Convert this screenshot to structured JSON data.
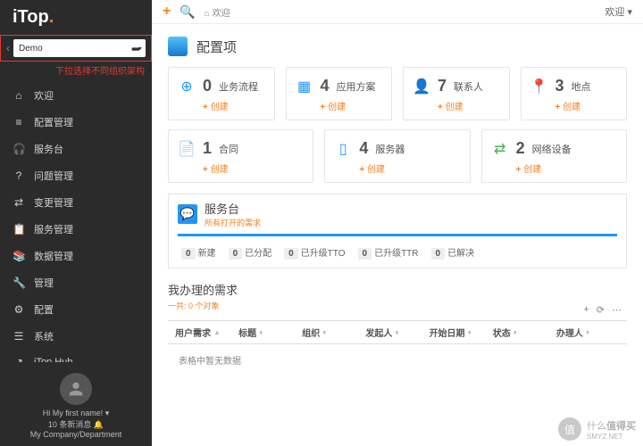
{
  "logo": {
    "text": "iTop",
    "accent": "."
  },
  "org": {
    "selected": "Demo",
    "hint": "下拉选择不同组织架构"
  },
  "nav": [
    {
      "icon": "home",
      "label": "欢迎"
    },
    {
      "icon": "db",
      "label": "配置管理"
    },
    {
      "icon": "headset",
      "label": "服务台"
    },
    {
      "icon": "question",
      "label": "问题管理"
    },
    {
      "icon": "exchange",
      "label": "变更管理"
    },
    {
      "icon": "clipboard",
      "label": "服务管理"
    },
    {
      "icon": "book",
      "label": "数据管理"
    },
    {
      "icon": "wrench",
      "label": "管理"
    },
    {
      "icon": "gear",
      "label": "配置"
    },
    {
      "icon": "sliders",
      "label": "系统"
    },
    {
      "icon": "share",
      "label": "iTop Hub"
    }
  ],
  "user": {
    "greeting": "Hi My first name! ▾",
    "msgs": "10 条新消息 🔔",
    "dept": "My Company/Department"
  },
  "topbar": {
    "breadcrumb_icon": "⌂",
    "breadcrumb": "欢迎",
    "right": "欢迎 ▾"
  },
  "section1": {
    "title": "配置项"
  },
  "cards1": [
    {
      "icon": "⊕",
      "color": "#2196f3",
      "count": "0",
      "label": "业务流程",
      "add": "创建"
    },
    {
      "icon": "▦",
      "color": "#2196f3",
      "count": "4",
      "label": "应用方案",
      "add": "创建"
    },
    {
      "icon": "👤",
      "color": "#2196f3",
      "count": "7",
      "label": "联系人",
      "add": "创建"
    },
    {
      "icon": "📍",
      "color": "#ff9800",
      "count": "3",
      "label": "地点",
      "add": "创建"
    }
  ],
  "cards2": [
    {
      "icon": "📄",
      "color": "#2196f3",
      "count": "1",
      "label": "合同",
      "add": "创建"
    },
    {
      "icon": "▯",
      "color": "#2196f3",
      "count": "4",
      "label": "服务器",
      "add": "创建"
    },
    {
      "icon": "⇄",
      "color": "#4caf50",
      "count": "2",
      "label": "网络设备",
      "add": "创建"
    }
  ],
  "service": {
    "title": "服务台",
    "subtitle": "所有打开的需求",
    "chips": [
      {
        "n": "0",
        "t": "新建"
      },
      {
        "n": "0",
        "t": "已分配"
      },
      {
        "n": "0",
        "t": "已升级TTO"
      },
      {
        "n": "0",
        "t": "已升级TTR"
      },
      {
        "n": "0",
        "t": "已解决"
      }
    ]
  },
  "myreq": {
    "title": "我办理的需求",
    "subtitle": "一共: 0 个对象",
    "cols": [
      "用户需求",
      "标题",
      "组织",
      "发起人",
      "开始日期",
      "状态",
      "办理人"
    ],
    "empty": "表格中暂无数据"
  },
  "watermark": {
    "char": "值",
    "text1": "什么",
    "text2": "值得买",
    "site": "SMYZ.NET"
  }
}
